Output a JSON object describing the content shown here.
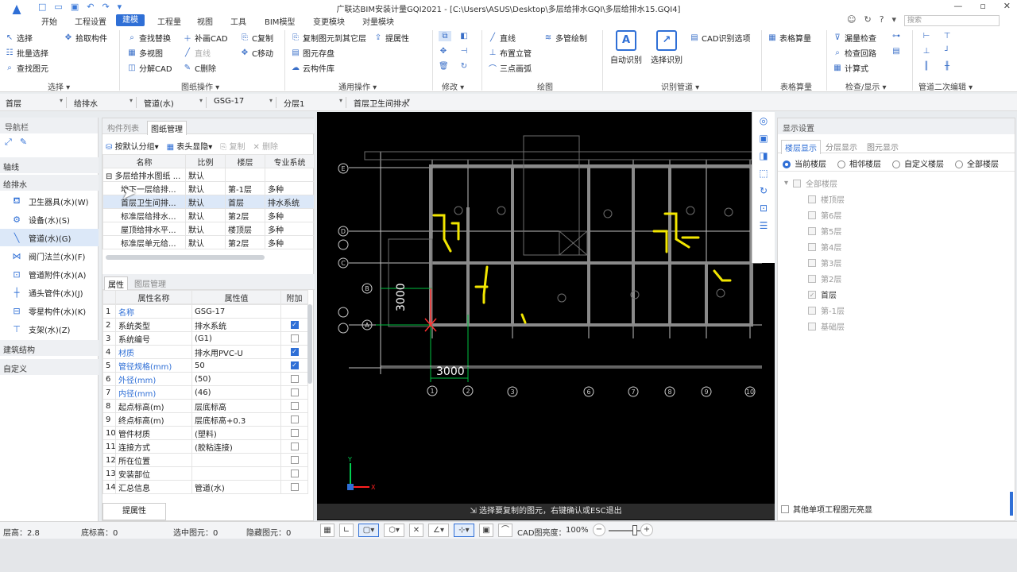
{
  "window": {
    "title": "广联达BIM安装计量GQI2021 - [C:\\Users\\ASUS\\Desktop\\多层给排水GQI\\多层给排水15.GQI4]",
    "search_placeholder": "搜索"
  },
  "menu": {
    "tabs": [
      "开始",
      "工程设置",
      "建模",
      "工程量",
      "视图",
      "工具",
      "BIM模型",
      "变更模块",
      "对量模块"
    ],
    "active": "建模"
  },
  "ribbon": {
    "select": {
      "items": [
        "选择",
        "拾取构件",
        "批量选择",
        "查找图元"
      ],
      "group": "选择 ▾"
    },
    "drawing_ops": {
      "items": [
        "查找替换",
        "补画CAD",
        "C复制",
        "多视图",
        "直线",
        "C移动",
        "分解CAD",
        "C删除"
      ],
      "group": "图纸操作 ▾"
    },
    "general_ops": {
      "items": [
        "复制图元到其它层",
        "提属性",
        "图元存盘",
        "云构件库"
      ],
      "group": "通用操作 ▾"
    },
    "modify": {
      "group": "修改 ▾"
    },
    "draw": {
      "items": [
        "直线",
        "多管绘制",
        "布置立管",
        "三点画弧"
      ],
      "group": "绘图"
    },
    "recognize": {
      "items": [
        "自动识别",
        "选择识别",
        "CAD识别选项"
      ],
      "group": "识别管道 ▾"
    },
    "table_calc": {
      "items": [
        "表格算量"
      ],
      "group": "表格算量"
    },
    "check": {
      "items": [
        "漏量检查",
        "检查回路",
        "计算式"
      ],
      "group": "检查/显示 ▾"
    },
    "pipe_edit": {
      "group": "管道二次编辑 ▾"
    }
  },
  "propbar": {
    "floor": "首层",
    "specialty": "给排水",
    "component_type": "管道(水)",
    "component": "GSG-17",
    "sublayer": "分层1",
    "drawing": "首层卫生间排水"
  },
  "nav": {
    "title": "导航栏",
    "categories": [
      "轴线",
      "给排水",
      "建筑结构",
      "自定义"
    ],
    "items": [
      {
        "label": "卫生器具(水)(W)",
        "icon": "sanitary-icon"
      },
      {
        "label": "设备(水)(S)",
        "icon": "equipment-icon"
      },
      {
        "label": "管道(水)(G)",
        "icon": "pipe-icon",
        "selected": true
      },
      {
        "label": "阀门法兰(水)(F)",
        "icon": "valve-icon"
      },
      {
        "label": "管道附件(水)(A)",
        "icon": "pipe-accessory-icon"
      },
      {
        "label": "通头管件(水)(J)",
        "icon": "fitting-icon"
      },
      {
        "label": "零星构件(水)(K)",
        "icon": "misc-icon"
      },
      {
        "label": "支架(水)(Z)",
        "icon": "bracket-icon"
      }
    ]
  },
  "drawings": {
    "tabs": [
      "构件列表",
      "图纸管理"
    ],
    "active_tab": "图纸管理",
    "toolbar": [
      "按默认分组",
      "表头显隐",
      "复制",
      "删除"
    ],
    "columns": [
      "名称",
      "比例",
      "楼层",
      "专业系统"
    ],
    "rows": [
      {
        "name": "多层给排水图纸 ...",
        "scale": "默认",
        "floor": "",
        "system": ""
      },
      {
        "name": "地下一层给排...",
        "scale": "默认",
        "floor": "第-1层",
        "system": "多种"
      },
      {
        "name": "首层卫生间排...",
        "scale": "默认",
        "floor": "首层",
        "system": "排水系统"
      },
      {
        "name": "标准层给排水...",
        "scale": "默认",
        "floor": "第2层",
        "system": "多种"
      },
      {
        "name": "屋顶给排水平...",
        "scale": "默认",
        "floor": "楼顶层",
        "system": "多种"
      },
      {
        "name": "标准层单元给...",
        "scale": "默认",
        "floor": "第2层",
        "system": "多种"
      }
    ]
  },
  "properties": {
    "tabs": [
      "属性",
      "图层管理"
    ],
    "active_tab": "属性",
    "columns": [
      "属性名称",
      "属性值",
      "附加"
    ],
    "rows": [
      {
        "n": "1",
        "name": "名称",
        "value": "GSG-17",
        "blue": true,
        "check": null
      },
      {
        "n": "2",
        "name": "系统类型",
        "value": "排水系统",
        "blue": false,
        "check": true
      },
      {
        "n": "3",
        "name": "系统编号",
        "value": "(G1)",
        "blue": false,
        "check": false
      },
      {
        "n": "4",
        "name": "材质",
        "value": "排水用PVC-U",
        "blue": true,
        "check": true
      },
      {
        "n": "5",
        "name": "管径规格(mm)",
        "value": "50",
        "blue": true,
        "check": true
      },
      {
        "n": "6",
        "name": "外径(mm)",
        "value": "(50)",
        "blue": true,
        "check": false
      },
      {
        "n": "7",
        "name": "内径(mm)",
        "value": "(46)",
        "blue": true,
        "check": false
      },
      {
        "n": "8",
        "name": "起点标高(m)",
        "value": "层底标高",
        "blue": false,
        "check": false
      },
      {
        "n": "9",
        "name": "终点标高(m)",
        "value": "层底标高+0.3",
        "blue": false,
        "check": false
      },
      {
        "n": "10",
        "name": "管件材质",
        "value": "(塑料)",
        "blue": false,
        "check": false
      },
      {
        "n": "11",
        "name": "连接方式",
        "value": "(胶粘连接)",
        "blue": false,
        "check": false
      },
      {
        "n": "12",
        "name": "所在位置",
        "value": "",
        "blue": false,
        "check": false
      },
      {
        "n": "13",
        "name": "安装部位",
        "value": "",
        "blue": false,
        "check": false
      },
      {
        "n": "14",
        "name": "汇总信息",
        "value": "管道(水)",
        "blue": false,
        "check": false
      }
    ],
    "extract_button": "提属性"
  },
  "canvas": {
    "status_message": "选择要复制的图元，右键确认或ESC退出",
    "dims": [
      "3000",
      "3000"
    ],
    "axis_rows": [
      "E",
      "D",
      "C",
      "B",
      "A"
    ],
    "axis_cols": [
      "1",
      "2",
      "3",
      "6",
      "7",
      "8",
      "9",
      "10"
    ]
  },
  "display": {
    "title": "显示设置",
    "tabs": [
      "楼层显示",
      "分层显示",
      "图元显示"
    ],
    "active_tab": "楼层显示",
    "radios": [
      "当前楼层",
      "相邻楼层",
      "自定义楼层",
      "全部楼层"
    ],
    "selected_radio": "当前楼层",
    "tree_root": "全部楼层",
    "floors": [
      {
        "name": "楼顶层",
        "checked": false
      },
      {
        "name": "第6层",
        "checked": false
      },
      {
        "name": "第5层",
        "checked": false
      },
      {
        "name": "第4层",
        "checked": false
      },
      {
        "name": "第3层",
        "checked": false
      },
      {
        "name": "第2层",
        "checked": false
      },
      {
        "name": "首层",
        "checked": true
      },
      {
        "name": "第-1层",
        "checked": false
      },
      {
        "name": "基础层",
        "checked": false
      }
    ],
    "other_highlight": "其他单项工程图元亮显"
  },
  "status": {
    "floor_height": "层高：2.8",
    "bottom_elev": "底标高：0",
    "selected": "选中图元：0",
    "hidden": "隐藏图元：0",
    "cad_brightness_label": "CAD图亮度：",
    "cad_brightness": "100%"
  },
  "colors": {
    "accent": "#2f6fd6",
    "pipe": "#f2e600",
    "canvas_bg": "#000000"
  }
}
